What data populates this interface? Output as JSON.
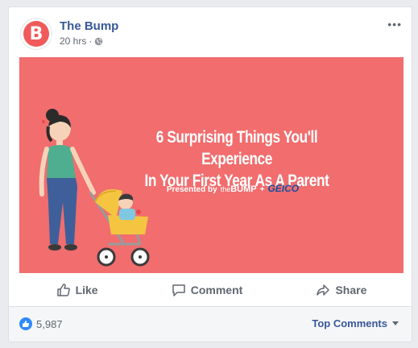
{
  "post": {
    "page_name": "The Bump",
    "avatar_letter": "B",
    "timestamp": "20 hrs",
    "separator": "·",
    "privacy_icon": "globe-icon",
    "more_icon": "more-options-icon",
    "more_label": "•••"
  },
  "media": {
    "headline_line1": "6 Surprising Things You'll Experience",
    "headline_line2": "In Your First Year As A Parent",
    "presented_by": "Presented by",
    "brand_the": "the",
    "brand_bump": "BUMP",
    "plus": "+",
    "sponsor": "GEICO",
    "background_color": "#f16d6e"
  },
  "actions": {
    "like_label": "Like",
    "comment_label": "Comment",
    "share_label": "Share"
  },
  "footer": {
    "reaction_count": "5,987",
    "reaction_icon": "like-reaction-icon",
    "sort_label": "Top Comments"
  },
  "colors": {
    "brand_link": "#365899",
    "like_blue": "#2e89ff",
    "avatar_red": "#f05a5a"
  }
}
